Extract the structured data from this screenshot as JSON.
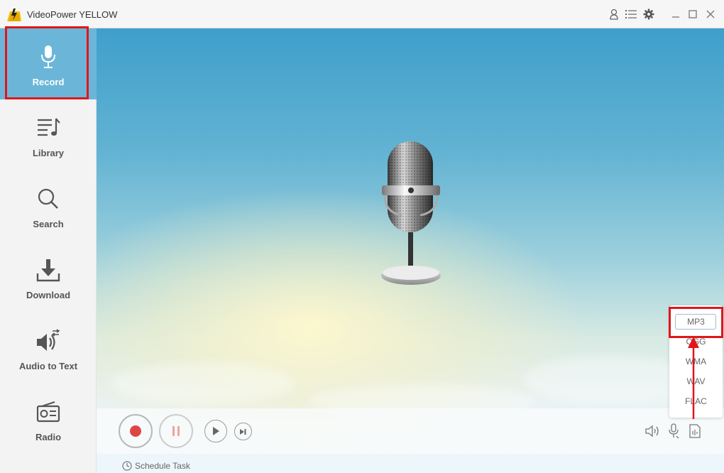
{
  "app": {
    "title": "VideoPower YELLOW"
  },
  "titlebar": {
    "icons": [
      "user-icon",
      "list-icon",
      "gear-icon",
      "minimize-icon",
      "maximize-icon",
      "close-icon"
    ]
  },
  "sidebar": {
    "items": [
      {
        "label": "Record",
        "icon": "microphone-icon",
        "active": true
      },
      {
        "label": "Library",
        "icon": "music-list-icon",
        "active": false
      },
      {
        "label": "Search",
        "icon": "search-icon",
        "active": false
      },
      {
        "label": "Download",
        "icon": "download-icon",
        "active": false
      },
      {
        "label": "Audio to Text",
        "icon": "speaker-convert-icon",
        "active": false
      },
      {
        "label": "Radio",
        "icon": "radio-icon",
        "active": false
      }
    ]
  },
  "controls": {
    "record_icon": "record-icon",
    "pause_icon": "pause-icon",
    "play_icon": "play-icon",
    "next_icon": "next-icon",
    "volume_icon": "volume-icon",
    "mic_source_icon": "microphone-source-icon",
    "format_icon": "audio-file-icon"
  },
  "status": {
    "schedule_label": "Schedule Task"
  },
  "format_menu": {
    "options": [
      "MP3",
      "OGG",
      "WMA",
      "WAV",
      "FLAC"
    ],
    "selected": "MP3"
  },
  "colors": {
    "accent": "#6bb6d8",
    "highlight": "#e0161b",
    "record": "#e04545"
  }
}
